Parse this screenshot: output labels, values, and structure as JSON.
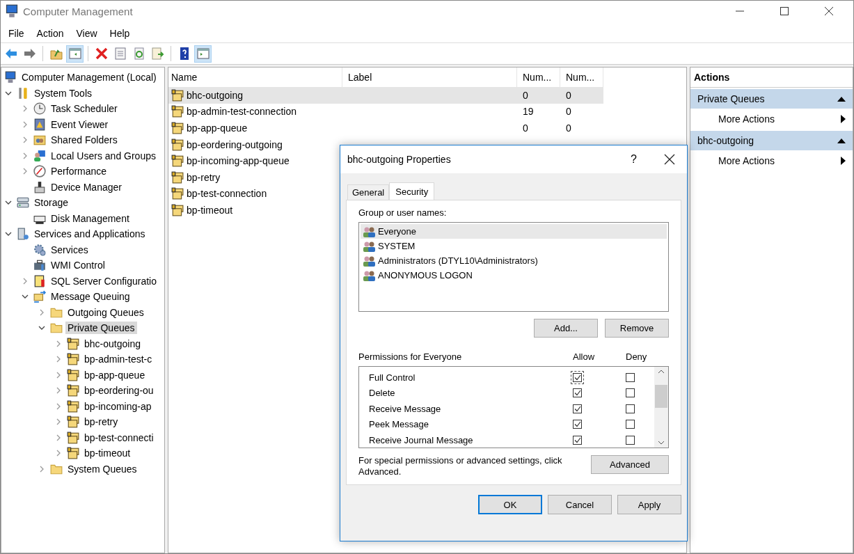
{
  "window": {
    "title": "Computer Management"
  },
  "menu": [
    "File",
    "Action",
    "View",
    "Help"
  ],
  "toolbar": [
    {
      "kind": "back",
      "pressed": false
    },
    {
      "kind": "forward",
      "pressed": false
    },
    {
      "kind": "separator"
    },
    {
      "kind": "up",
      "pressed": false
    },
    {
      "kind": "tree-pane",
      "pressed": true
    },
    {
      "kind": "separator"
    },
    {
      "kind": "delete",
      "pressed": false
    },
    {
      "kind": "properties",
      "pressed": false
    },
    {
      "kind": "refresh",
      "pressed": false
    },
    {
      "kind": "export",
      "pressed": false
    },
    {
      "kind": "separator"
    },
    {
      "kind": "help",
      "pressed": false
    },
    {
      "kind": "action-pane",
      "pressed": true
    }
  ],
  "tree": [
    {
      "label": "Computer Management (Local)",
      "kind": "computer",
      "selected": false,
      "children": [
        {
          "label": "System Tools",
          "kind": "tools",
          "selected": false,
          "expanded": true,
          "children": [
            {
              "label": "Task Scheduler",
              "kind": "clock",
              "selected": false,
              "expanded": false
            },
            {
              "label": "Event Viewer",
              "kind": "log",
              "selected": false,
              "expanded": false
            },
            {
              "label": "Shared Folders",
              "kind": "shared",
              "selected": false,
              "expanded": false
            },
            {
              "label": "Local Users and Groups",
              "kind": "users",
              "selected": false,
              "expanded": false
            },
            {
              "label": "Performance",
              "kind": "gauge",
              "selected": false,
              "expanded": false
            },
            {
              "label": "Device Manager",
              "kind": "device",
              "selected": false
            }
          ]
        },
        {
          "label": "Storage",
          "kind": "storage",
          "selected": false,
          "expanded": true,
          "children": [
            {
              "label": "Disk Management",
              "kind": "disk",
              "selected": false
            }
          ]
        },
        {
          "label": "Services and Applications",
          "kind": "server",
          "selected": false,
          "expanded": true,
          "children": [
            {
              "label": "Services",
              "kind": "gear",
              "selected": false
            },
            {
              "label": "WMI Control",
              "kind": "wmi",
              "selected": false
            },
            {
              "label": "SQL Server Configuratio",
              "kind": "sql",
              "selected": false,
              "expanded": false
            },
            {
              "label": "Message Queuing",
              "kind": "mq",
              "selected": false,
              "expanded": true,
              "children": [
                {
                  "label": "Outgoing Queues",
                  "kind": "folder",
                  "selected": false,
                  "expanded": false
                },
                {
                  "label": "Private Queues",
                  "kind": "folder",
                  "selected": true,
                  "expanded": true,
                  "children": [
                    {
                      "label": "bhc-outgoing",
                      "kind": "queue",
                      "selected": false,
                      "expanded": false
                    },
                    {
                      "label": "bp-admin-test-c",
                      "kind": "queue",
                      "selected": false,
                      "expanded": false
                    },
                    {
                      "label": "bp-app-queue",
                      "kind": "queue",
                      "selected": false,
                      "expanded": false
                    },
                    {
                      "label": "bp-eordering-ou",
                      "kind": "queue",
                      "selected": false,
                      "expanded": false
                    },
                    {
                      "label": "bp-incoming-ap",
                      "kind": "queue",
                      "selected": false,
                      "expanded": false
                    },
                    {
                      "label": "bp-retry",
                      "kind": "queue",
                      "selected": false,
                      "expanded": false
                    },
                    {
                      "label": "bp-test-connecti",
                      "kind": "queue",
                      "selected": false,
                      "expanded": false
                    },
                    {
                      "label": "bp-timeout",
                      "kind": "queue",
                      "selected": false,
                      "expanded": false
                    }
                  ]
                },
                {
                  "label": "System Queues",
                  "kind": "folder",
                  "selected": false,
                  "expanded": false
                }
              ]
            }
          ]
        }
      ]
    }
  ],
  "list": {
    "columns": [
      "Name",
      "Label",
      "Num...",
      "Num..."
    ],
    "rows": [
      {
        "name": "bhc-outgoing",
        "selected": true,
        "column_3": "0",
        "column_4": "0"
      },
      {
        "name": "bp-admin-test-connection",
        "selected": false,
        "column_3": "19",
        "column_4": "0"
      },
      {
        "name": "bp-app-queue",
        "selected": false,
        "column_3": "0",
        "column_4": "0"
      },
      {
        "name": "bp-eordering-outgoing",
        "selected": false
      },
      {
        "name": "bp-incoming-app-queue",
        "selected": false
      },
      {
        "name": "bp-retry",
        "selected": false
      },
      {
        "name": "bp-test-connection",
        "selected": false
      },
      {
        "name": "bp-timeout",
        "selected": false
      }
    ]
  },
  "actions": {
    "title": "Actions",
    "sections": [
      {
        "title": "Private Queues",
        "items": [
          "More Actions"
        ]
      },
      {
        "title": "bhc-outgoing",
        "items": [
          "More Actions"
        ]
      }
    ]
  },
  "dialog": {
    "title": "bhc-outgoing Properties",
    "help": "?",
    "tabs": [
      {
        "label": "General",
        "selected": false
      },
      {
        "label": "Security",
        "selected": true
      }
    ],
    "group_label": "Group or user names:",
    "users": [
      {
        "name": "Everyone",
        "selected": true
      },
      {
        "name": "SYSTEM",
        "selected": false
      },
      {
        "name": "Administrators (DTYL10\\Administrators)",
        "selected": false
      },
      {
        "name": "ANONYMOUS LOGON",
        "selected": false
      }
    ],
    "user_buttons": [
      "Add...",
      "Remove"
    ],
    "permissions_label": "Permissions for Everyone",
    "allow_label": "Allow",
    "deny_label": "Deny",
    "permissions": [
      {
        "name": "Full Control",
        "allow": true,
        "deny": false,
        "focused": true
      },
      {
        "name": "Delete",
        "allow": true,
        "deny": false,
        "focused": false
      },
      {
        "name": "Receive Message",
        "allow": true,
        "deny": false,
        "focused": false
      },
      {
        "name": "Peek Message",
        "allow": true,
        "deny": false,
        "focused": false
      },
      {
        "name": "Receive Journal Message",
        "allow": true,
        "deny": false,
        "focused": false
      }
    ],
    "note": "For special permissions or advanced settings, click Advanced.",
    "advanced_button": "Advanced",
    "buttons": [
      {
        "label": "OK",
        "default": true
      },
      {
        "label": "Cancel",
        "default": false
      },
      {
        "label": "Apply",
        "default": false
      }
    ]
  }
}
